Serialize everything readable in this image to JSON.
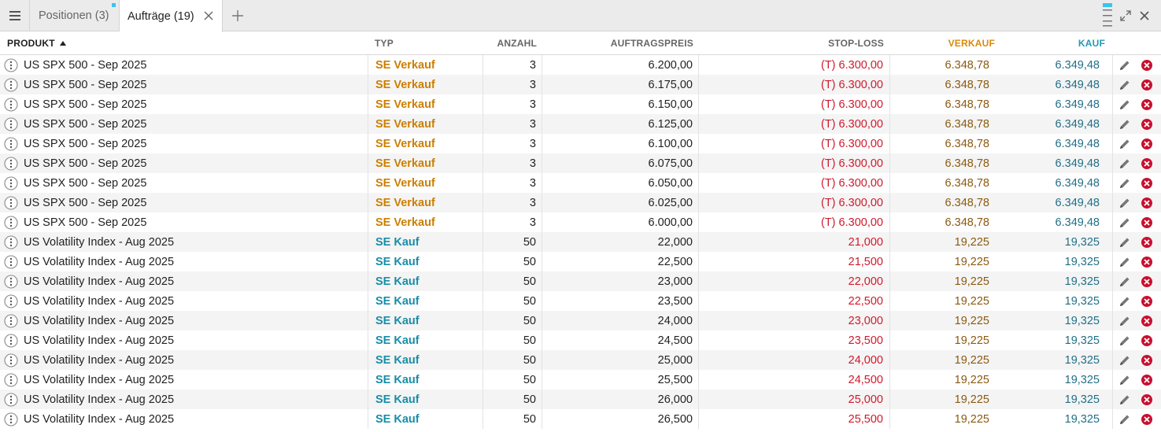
{
  "tabs": [
    {
      "label": "Positionen (3)",
      "active": false
    },
    {
      "label": "Aufträge (19)",
      "active": true
    }
  ],
  "icons": {
    "menu": "hamburger-icon",
    "close_tab": "close-icon",
    "add_tab": "plus-icon",
    "resize": "resize-indicator-icon",
    "expand": "expand-icon",
    "window_close": "close-icon",
    "row_info": "info-dots-icon",
    "edit": "pencil-icon",
    "delete": "delete-circle-icon"
  },
  "colors": {
    "sell": "#cc7f00",
    "buy": "#188ea8",
    "stop_loss": "#d0192b",
    "tab_indicator": "#3ac4ee"
  },
  "columns": {
    "produkt": "PRODUKT",
    "typ": "TYP",
    "anzahl": "ANZAHL",
    "auftragspreis": "AUFTRAGSPREIS",
    "stop_loss": "STOP-LOSS",
    "verkauf": "VERKAUF",
    "kauf": "KAUF"
  },
  "sort": {
    "column": "produkt",
    "direction": "ascending"
  },
  "orders": [
    {
      "produkt": "US SPX 500 - Sep 2025",
      "typ": "SE Verkauf",
      "side": "sell",
      "anzahl": "3",
      "auftragspreis": "6.200,00",
      "stop_loss": "(T) 6.300,00",
      "verkauf": "6.348,78",
      "kauf": "6.349,48"
    },
    {
      "produkt": "US SPX 500 - Sep 2025",
      "typ": "SE Verkauf",
      "side": "sell",
      "anzahl": "3",
      "auftragspreis": "6.175,00",
      "stop_loss": "(T) 6.300,00",
      "verkauf": "6.348,78",
      "kauf": "6.349,48"
    },
    {
      "produkt": "US SPX 500 - Sep 2025",
      "typ": "SE Verkauf",
      "side": "sell",
      "anzahl": "3",
      "auftragspreis": "6.150,00",
      "stop_loss": "(T) 6.300,00",
      "verkauf": "6.348,78",
      "kauf": "6.349,48"
    },
    {
      "produkt": "US SPX 500 - Sep 2025",
      "typ": "SE Verkauf",
      "side": "sell",
      "anzahl": "3",
      "auftragspreis": "6.125,00",
      "stop_loss": "(T) 6.300,00",
      "verkauf": "6.348,78",
      "kauf": "6.349,48"
    },
    {
      "produkt": "US SPX 500 - Sep 2025",
      "typ": "SE Verkauf",
      "side": "sell",
      "anzahl": "3",
      "auftragspreis": "6.100,00",
      "stop_loss": "(T) 6.300,00",
      "verkauf": "6.348,78",
      "kauf": "6.349,48"
    },
    {
      "produkt": "US SPX 500 - Sep 2025",
      "typ": "SE Verkauf",
      "side": "sell",
      "anzahl": "3",
      "auftragspreis": "6.075,00",
      "stop_loss": "(T) 6.300,00",
      "verkauf": "6.348,78",
      "kauf": "6.349,48"
    },
    {
      "produkt": "US SPX 500 - Sep 2025",
      "typ": "SE Verkauf",
      "side": "sell",
      "anzahl": "3",
      "auftragspreis": "6.050,00",
      "stop_loss": "(T) 6.300,00",
      "verkauf": "6.348,78",
      "kauf": "6.349,48"
    },
    {
      "produkt": "US SPX 500 - Sep 2025",
      "typ": "SE Verkauf",
      "side": "sell",
      "anzahl": "3",
      "auftragspreis": "6.025,00",
      "stop_loss": "(T) 6.300,00",
      "verkauf": "6.348,78",
      "kauf": "6.349,48"
    },
    {
      "produkt": "US SPX 500 - Sep 2025",
      "typ": "SE Verkauf",
      "side": "sell",
      "anzahl": "3",
      "auftragspreis": "6.000,00",
      "stop_loss": "(T) 6.300,00",
      "verkauf": "6.348,78",
      "kauf": "6.349,48"
    },
    {
      "produkt": "US Volatility Index - Aug 2025",
      "typ": "SE Kauf",
      "side": "buy",
      "anzahl": "50",
      "auftragspreis": "22,000",
      "stop_loss": "21,000",
      "verkauf": "19,225",
      "kauf": "19,325"
    },
    {
      "produkt": "US Volatility Index - Aug 2025",
      "typ": "SE Kauf",
      "side": "buy",
      "anzahl": "50",
      "auftragspreis": "22,500",
      "stop_loss": "21,500",
      "verkauf": "19,225",
      "kauf": "19,325"
    },
    {
      "produkt": "US Volatility Index - Aug 2025",
      "typ": "SE Kauf",
      "side": "buy",
      "anzahl": "50",
      "auftragspreis": "23,000",
      "stop_loss": "22,000",
      "verkauf": "19,225",
      "kauf": "19,325"
    },
    {
      "produkt": "US Volatility Index - Aug 2025",
      "typ": "SE Kauf",
      "side": "buy",
      "anzahl": "50",
      "auftragspreis": "23,500",
      "stop_loss": "22,500",
      "verkauf": "19,225",
      "kauf": "19,325"
    },
    {
      "produkt": "US Volatility Index - Aug 2025",
      "typ": "SE Kauf",
      "side": "buy",
      "anzahl": "50",
      "auftragspreis": "24,000",
      "stop_loss": "23,000",
      "verkauf": "19,225",
      "kauf": "19,325"
    },
    {
      "produkt": "US Volatility Index - Aug 2025",
      "typ": "SE Kauf",
      "side": "buy",
      "anzahl": "50",
      "auftragspreis": "24,500",
      "stop_loss": "23,500",
      "verkauf": "19,225",
      "kauf": "19,325"
    },
    {
      "produkt": "US Volatility Index - Aug 2025",
      "typ": "SE Kauf",
      "side": "buy",
      "anzahl": "50",
      "auftragspreis": "25,000",
      "stop_loss": "24,000",
      "verkauf": "19,225",
      "kauf": "19,325"
    },
    {
      "produkt": "US Volatility Index - Aug 2025",
      "typ": "SE Kauf",
      "side": "buy",
      "anzahl": "50",
      "auftragspreis": "25,500",
      "stop_loss": "24,500",
      "verkauf": "19,225",
      "kauf": "19,325"
    },
    {
      "produkt": "US Volatility Index - Aug 2025",
      "typ": "SE Kauf",
      "side": "buy",
      "anzahl": "50",
      "auftragspreis": "26,000",
      "stop_loss": "25,000",
      "verkauf": "19,225",
      "kauf": "19,325"
    },
    {
      "produkt": "US Volatility Index - Aug 2025",
      "typ": "SE Kauf",
      "side": "buy",
      "anzahl": "50",
      "auftragspreis": "26,500",
      "stop_loss": "25,500",
      "verkauf": "19,225",
      "kauf": "19,325"
    }
  ]
}
